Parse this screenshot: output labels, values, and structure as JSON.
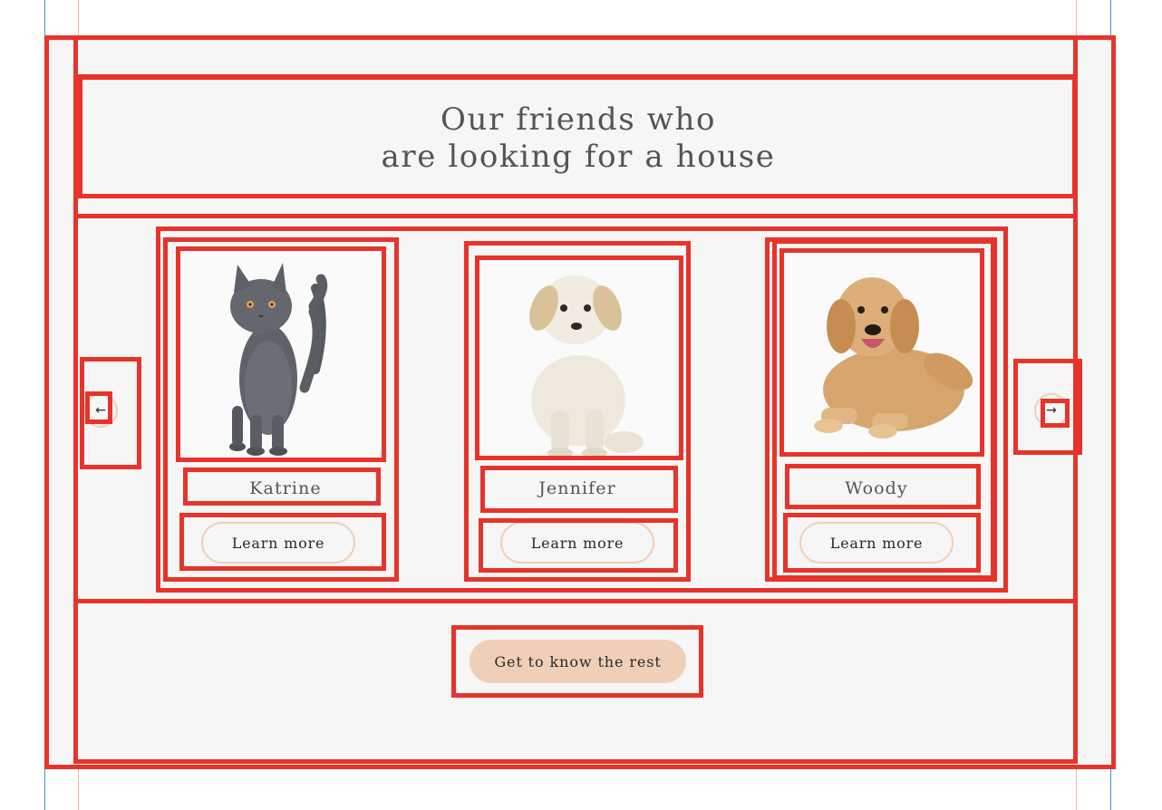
{
  "section": {
    "title_lines": [
      "Our friends who",
      "are looking for a house"
    ]
  },
  "slider": {
    "prev_icon": "arrow-left-icon",
    "next_icon": "arrow-right-icon",
    "prev_glyph": "←",
    "next_glyph": "→",
    "pets": [
      {
        "name": "Katrine",
        "animal": "cat",
        "button": "Learn more"
      },
      {
        "name": "Jennifer",
        "animal": "puppy",
        "button": "Learn more"
      },
      {
        "name": "Woody",
        "animal": "dog",
        "button": "Learn more"
      }
    ]
  },
  "cta": {
    "label": "Get to know the rest"
  },
  "colors": {
    "background": "#f6f6f6",
    "accent": "#f0cfb8",
    "text": "#545454",
    "overlay_outline": "#e8332a",
    "guide_blue": "#3b8ef0",
    "guide_peach": "#e8b8a4"
  }
}
